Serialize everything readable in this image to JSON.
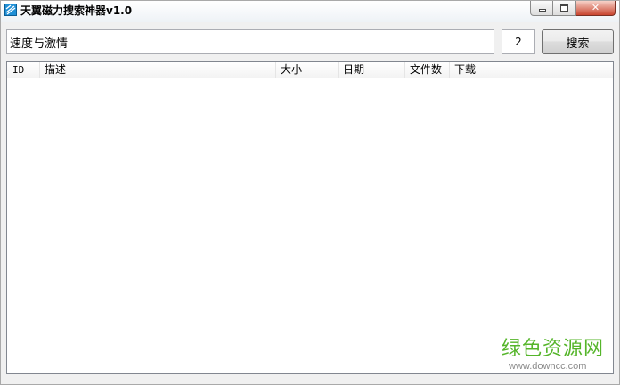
{
  "window": {
    "title": "天翼磁力搜索神器v1.0",
    "close_glyph": "✕"
  },
  "search": {
    "query": "速度与激情",
    "page": "2",
    "button_label": "搜索"
  },
  "results": {
    "columns": [
      "ID",
      "描述",
      "大小",
      "日期",
      "文件数",
      "下载"
    ],
    "rows": []
  },
  "watermark": {
    "text_cn": "绿色资源网",
    "text_en": "www.downcc.com",
    "color": "#55b52a"
  }
}
